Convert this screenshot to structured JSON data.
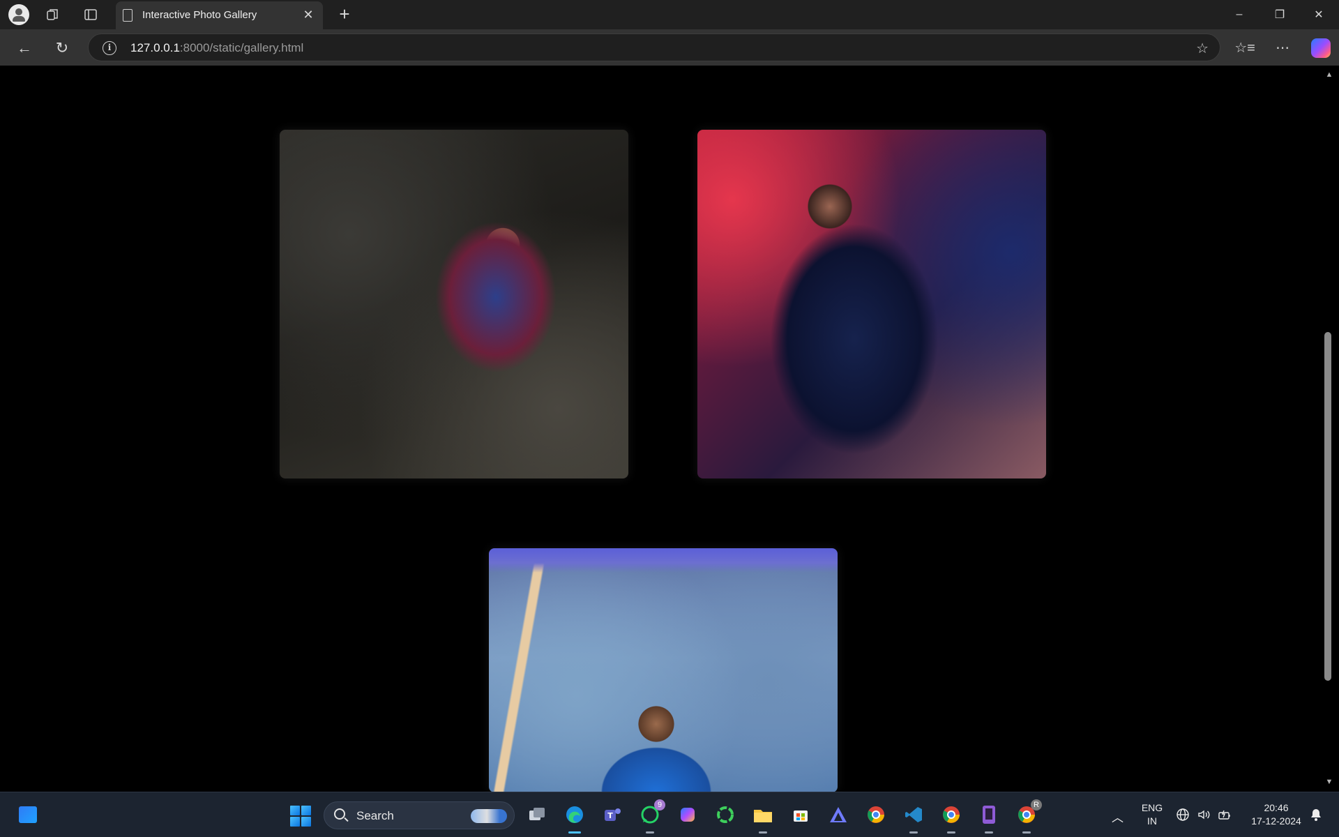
{
  "browser": {
    "tab_title": "Interactive Photo Gallery",
    "tab_close": "✕",
    "new_tab": "+",
    "url_host": "127.0.0.1",
    "url_rest": ":8000/static/gallery.html",
    "window_controls": {
      "minimize": "–",
      "restore": "❐",
      "close": "✕"
    },
    "nav_icons": {
      "back": "←",
      "reload": "↻",
      "info": "i",
      "favorite": "☆",
      "favorites": "☆≡",
      "more": "⋯"
    }
  },
  "gallery": {
    "photos": [
      {
        "subject": "footballer-portrait",
        "colors": [
          "#2d3f8a",
          "#6b1f3a"
        ]
      },
      {
        "subject": "man-in-car-portrait",
        "colors": [
          "#b01e3a",
          "#16224d"
        ]
      },
      {
        "subject": "cricketer-portrait",
        "colors": [
          "#1f6fd6",
          "#7d9cc4"
        ]
      }
    ]
  },
  "taskbar": {
    "search_label": "Search",
    "whatsapp_badge": "9",
    "chrome_profile_badge": "R",
    "language_top": "ENG",
    "language_bottom": "IN",
    "time": "20:46",
    "date": "17-12-2024",
    "icons": [
      "widgets-icon",
      "start-icon",
      "task-view-icon",
      "edge-icon",
      "teams-icon",
      "whatsapp-icon",
      "copilot-icon",
      "circular-app-icon",
      "file-explorer-icon",
      "store-icon",
      "app-icon",
      "chrome-icon",
      "vscode-icon",
      "chrome-icon",
      "phone-app-icon",
      "chrome-icon"
    ]
  },
  "colors": {
    "accent": "#4cc2ff",
    "taskbar_bg": "#1c2430",
    "browser_chrome": "#333333"
  }
}
